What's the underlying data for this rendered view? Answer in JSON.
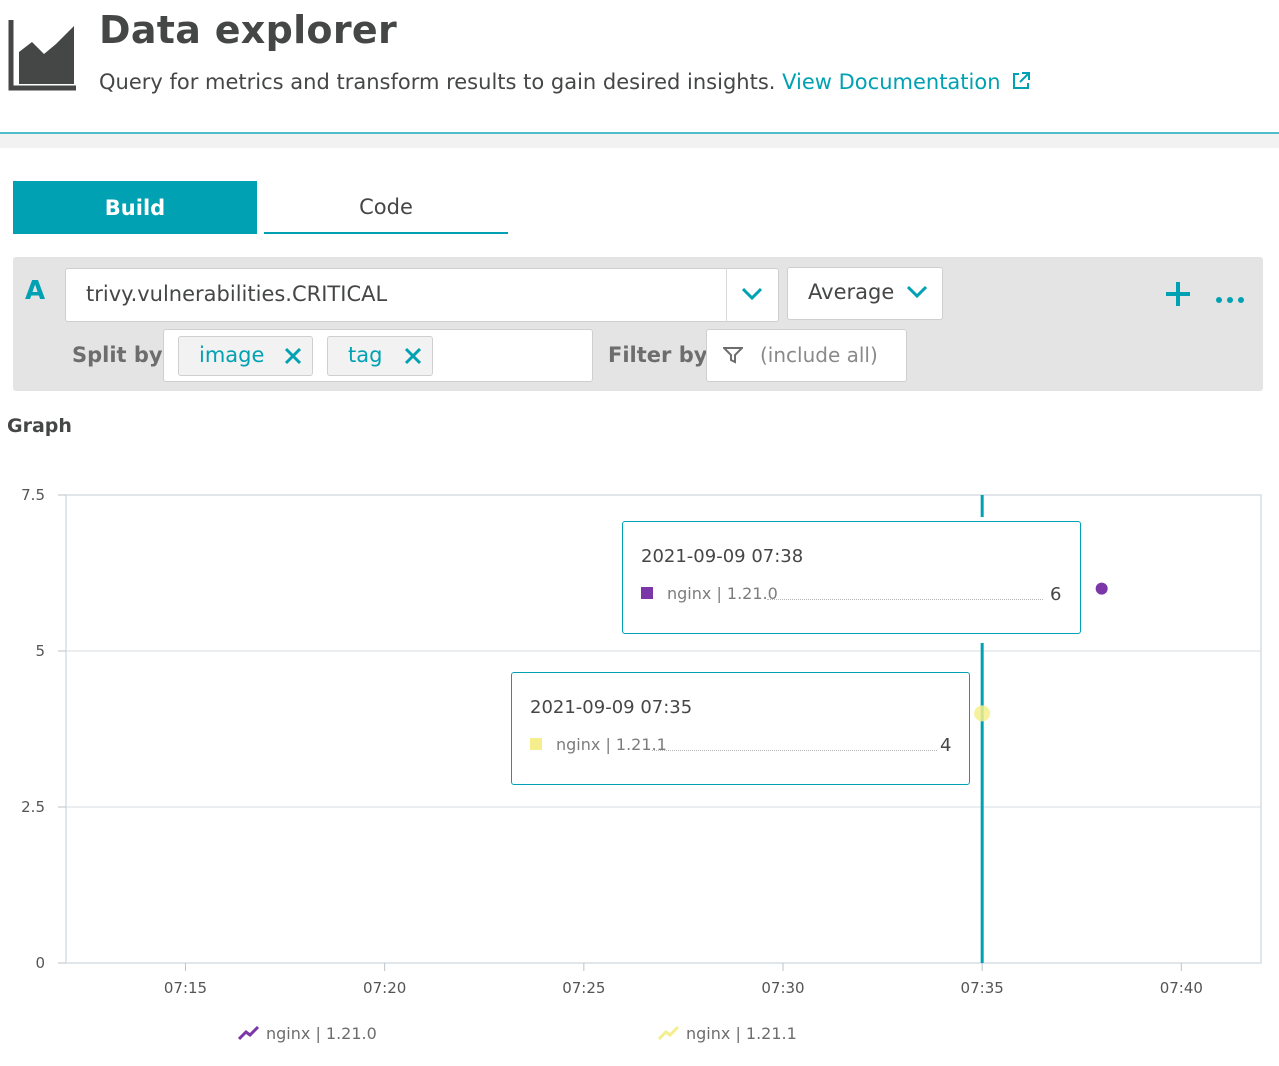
{
  "header": {
    "title": "Data explorer",
    "subtitle": "Query for metrics and transform results to gain desired insights.",
    "doc_link": "View Documentation",
    "icon": "area-chart-icon",
    "link_icon": "external-link-icon"
  },
  "tabs": [
    {
      "label": "Build",
      "active": true
    },
    {
      "label": "Code",
      "active": false
    }
  ],
  "query": {
    "letter": "A",
    "metric": "trivy.vulnerabilities.CRITICAL",
    "aggregation": "Average",
    "split_label": "Split by",
    "split_chips": [
      "image",
      "tag"
    ],
    "filter_label": "Filter by",
    "filter_placeholder": "(include all)"
  },
  "graph": {
    "title": "Graph"
  },
  "colors": {
    "accent": "#00a1b2",
    "series_1210": "#7b36a8",
    "series_1211": "#f4ee8c"
  },
  "tooltips": [
    {
      "time": "2021-09-09 07:38",
      "series": "nginx | 1.21.0",
      "value": "6"
    },
    {
      "time": "2021-09-09 07:35",
      "series": "nginx | 1.21.1",
      "value": "4"
    }
  ],
  "chart_data": {
    "type": "scatter",
    "title": "",
    "xlabel": "",
    "ylabel": "",
    "x_ticks": [
      "07:15",
      "07:20",
      "07:25",
      "07:30",
      "07:35",
      "07:40"
    ],
    "y_ticks": [
      "0",
      "2.5",
      "5",
      "7.5"
    ],
    "ylim": [
      0,
      7.5
    ],
    "xlim": [
      "07:12",
      "07:42"
    ],
    "grid": true,
    "legend_position": "bottom",
    "cursor_x": "07:35",
    "series": [
      {
        "name": "nginx | 1.21.0",
        "color": "#7b36a8",
        "points": [
          {
            "x": "07:38",
            "y": 6
          }
        ]
      },
      {
        "name": "nginx | 1.21.1",
        "color": "#f4ee8c",
        "points": [
          {
            "x": "07:35",
            "y": 4
          }
        ]
      }
    ]
  }
}
